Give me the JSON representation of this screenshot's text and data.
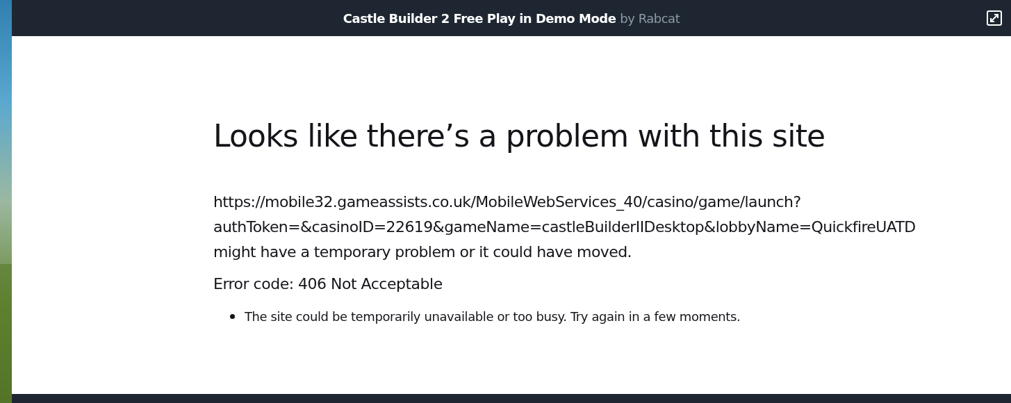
{
  "header": {
    "title": "Castle Builder 2 Free Play in Demo Mode",
    "byline": "by Rabcat"
  },
  "error_page": {
    "heading": "Looks like there’s a problem with this site",
    "message_lines": [
      "https://mobile32.gameassists.co.uk/MobileWebServices_40/casino/game/launch?",
      "authToken=&casinoID=22619&gameName=castleBuilderIIDesktop&lobbyName=QuickfireUATD",
      "might have a temporary problem or it could have moved."
    ],
    "error_code": "Error code: 406 Not Acceptable",
    "suggestions": [
      "The site could be temporarily unavailable or too busy. Try again in a few moments."
    ]
  }
}
